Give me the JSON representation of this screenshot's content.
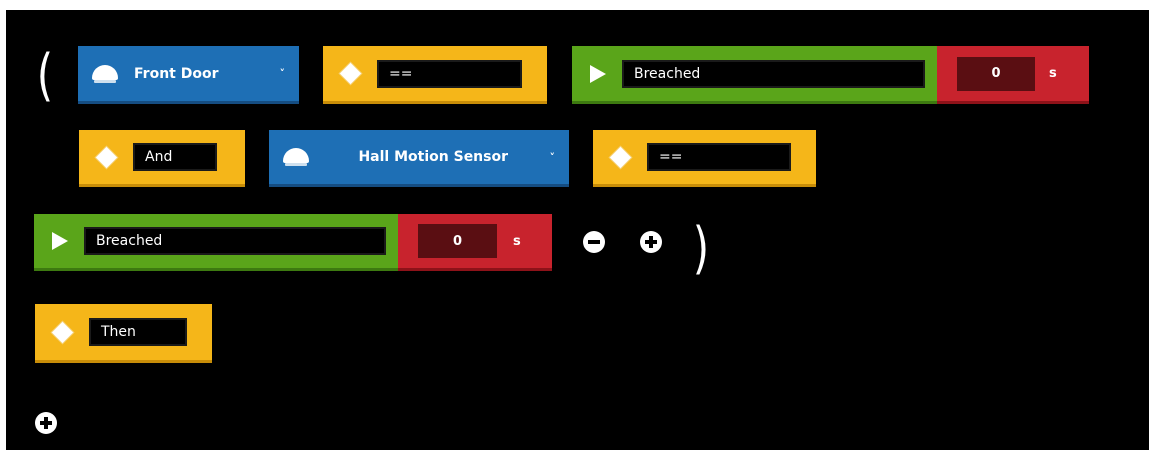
{
  "rule": {
    "open_paren": "(",
    "close_paren": ")",
    "device1": {
      "label": "Front Door",
      "chevron": "˅",
      "icon": "sensor-dome-icon"
    },
    "operator1": {
      "value": "=="
    },
    "state1": {
      "value": "Breached"
    },
    "delay1": {
      "value": "0",
      "unit": "s"
    },
    "logic1": {
      "value": "And"
    },
    "device2": {
      "label": "Hall Motion Sensor",
      "chevron": "˅",
      "icon": "sensor-dome-icon"
    },
    "operator2": {
      "value": "=="
    },
    "state2": {
      "value": "Breached"
    },
    "delay2": {
      "value": "0",
      "unit": "s"
    },
    "then": {
      "value": "Then"
    }
  },
  "controls": {
    "remove_condition_icon": "minus-circle-icon",
    "add_condition_icon": "plus-circle-icon",
    "add_action_icon": "plus-circle-icon"
  },
  "colors": {
    "device_blue": "#1e6fb5",
    "operator_yellow": "#f5b619",
    "state_green": "#5aa51a",
    "delay_red": "#c8232d",
    "background": "#000000"
  }
}
